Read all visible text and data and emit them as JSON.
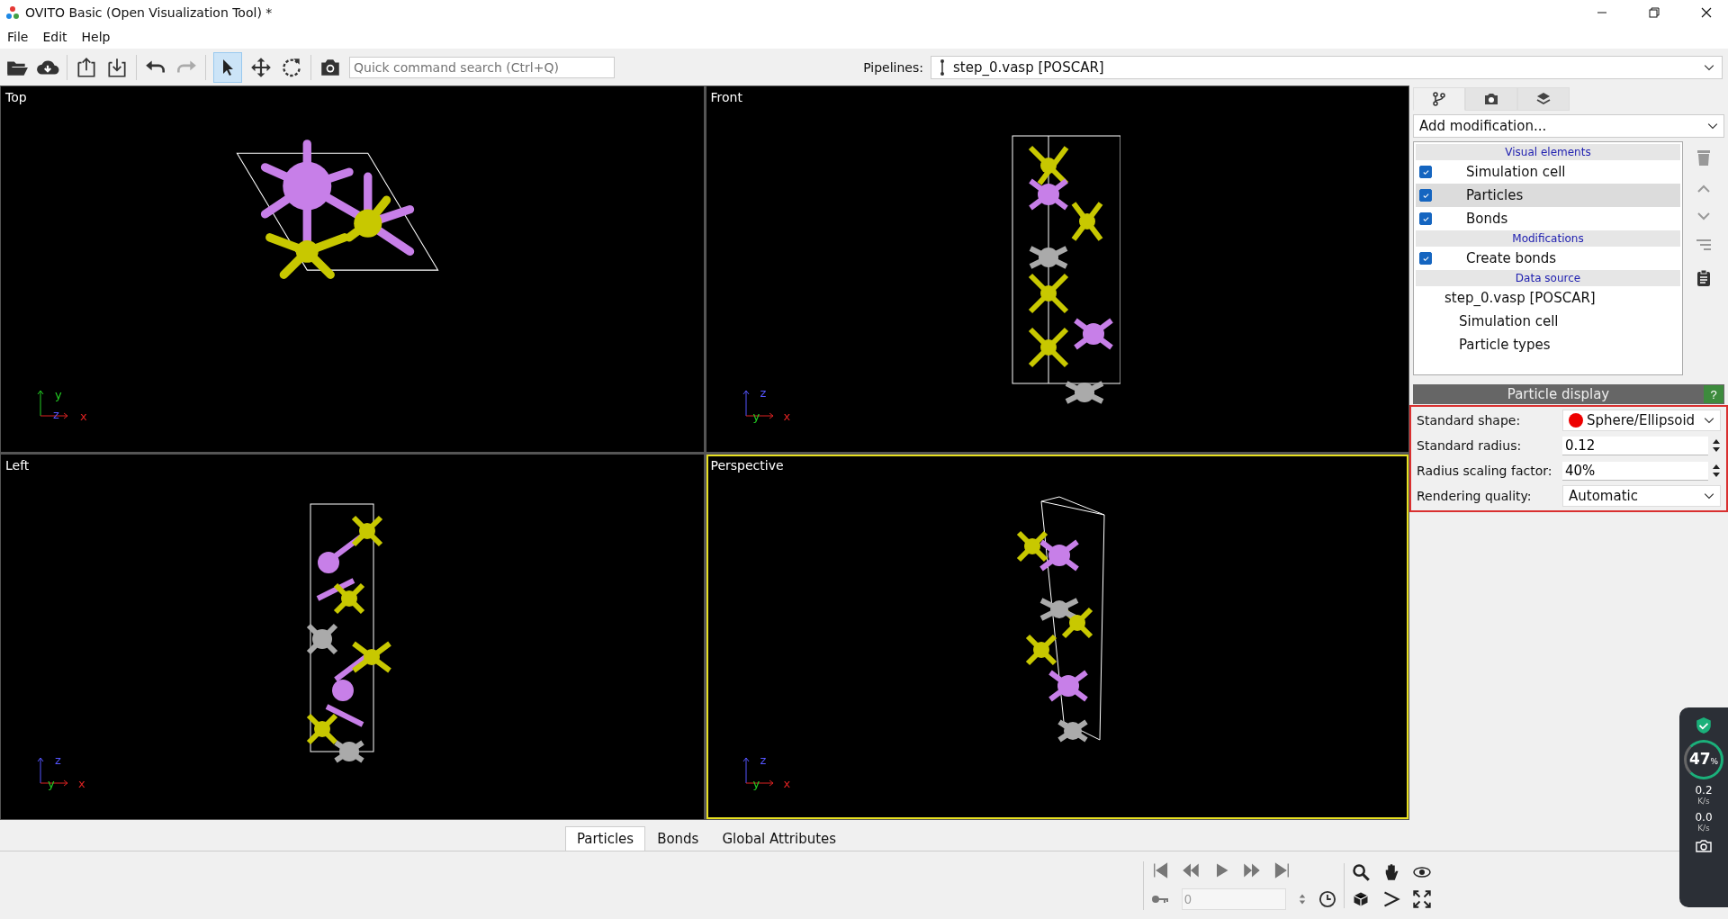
{
  "window": {
    "title": "OVITO Basic (Open Visualization Tool) *"
  },
  "menu": [
    "File",
    "Edit",
    "Help"
  ],
  "toolbar": {
    "search": {
      "placeholder": "Quick command search (Ctrl+Q)"
    },
    "select_mode_on": true,
    "pipelines_label": "Pipelines:",
    "pipeline": "step_0.vasp [POSCAR]"
  },
  "viewports": [
    {
      "title": "Top",
      "kind": "top",
      "active": false,
      "axes": [
        {
          "label": "y",
          "color": "#22cc22"
        },
        {
          "label": "z",
          "color": "#5555ff"
        },
        {
          "label": "x",
          "color": "#dd2222"
        }
      ]
    },
    {
      "title": "Front",
      "kind": "front",
      "active": false,
      "axes": [
        {
          "label": "z",
          "color": "#5555ff"
        },
        {
          "label": "y",
          "color": "#22cc22"
        },
        {
          "label": "x",
          "color": "#dd2222"
        }
      ]
    },
    {
      "title": "Left",
      "kind": "left",
      "active": false,
      "axes": [
        {
          "label": "z",
          "color": "#5555ff"
        },
        {
          "label": "y",
          "color": "#22cc22"
        },
        {
          "label": "x",
          "color": "#dd2222"
        }
      ]
    },
    {
      "title": "Perspective",
      "kind": "perspective",
      "active": true,
      "axes": [
        {
          "label": "z",
          "color": "#5555ff"
        },
        {
          "label": "y",
          "color": "#22cc22"
        },
        {
          "label": "x",
          "color": "#dd2222"
        }
      ]
    }
  ],
  "panel": {
    "tabs": [
      {
        "kind": "pipeline",
        "selected": true
      },
      {
        "kind": "render",
        "selected": false
      },
      {
        "kind": "layers",
        "selected": false
      }
    ],
    "add_modification": "Add modification...",
    "sections": [
      {
        "heading": "Visual elements",
        "items": [
          {
            "label": "Simulation cell",
            "checked": true,
            "selected": false
          },
          {
            "label": "Particles",
            "checked": true,
            "selected": true
          },
          {
            "label": "Bonds",
            "checked": true,
            "selected": false
          }
        ]
      },
      {
        "heading": "Modifications",
        "items": [
          {
            "label": "Create bonds",
            "checked": true,
            "selected": false
          }
        ]
      },
      {
        "heading": "Data source",
        "source": {
          "label": "step_0.vasp [POSCAR]",
          "children": [
            {
              "label": "Simulation cell"
            },
            {
              "label": "Particle types"
            }
          ]
        }
      }
    ],
    "editor": {
      "title": "Particle display",
      "help": "?",
      "fields": [
        {
          "label": "Standard shape:",
          "kind": "dropdown",
          "value": "Sphere/Ellipsoid",
          "color": "#ee0000"
        },
        {
          "label": "Standard radius:",
          "kind": "spinner",
          "value": "0.12"
        },
        {
          "label": "Radius scaling factor:",
          "kind": "spinner",
          "value": "40%"
        },
        {
          "label": "Rendering quality:",
          "kind": "dropdown",
          "value": "Automatic"
        }
      ]
    }
  },
  "data_tabs": [
    {
      "label": "Particles",
      "selected": true
    },
    {
      "label": "Bonds",
      "selected": false
    },
    {
      "label": "Global Attributes",
      "selected": false
    }
  ],
  "animation": {
    "frame": "0"
  },
  "net_widget": {
    "percent": "47",
    "percent_unit": "%",
    "up": "0.2",
    "up_unit": "K/s",
    "down": "0.0",
    "down_unit": "K/s"
  }
}
